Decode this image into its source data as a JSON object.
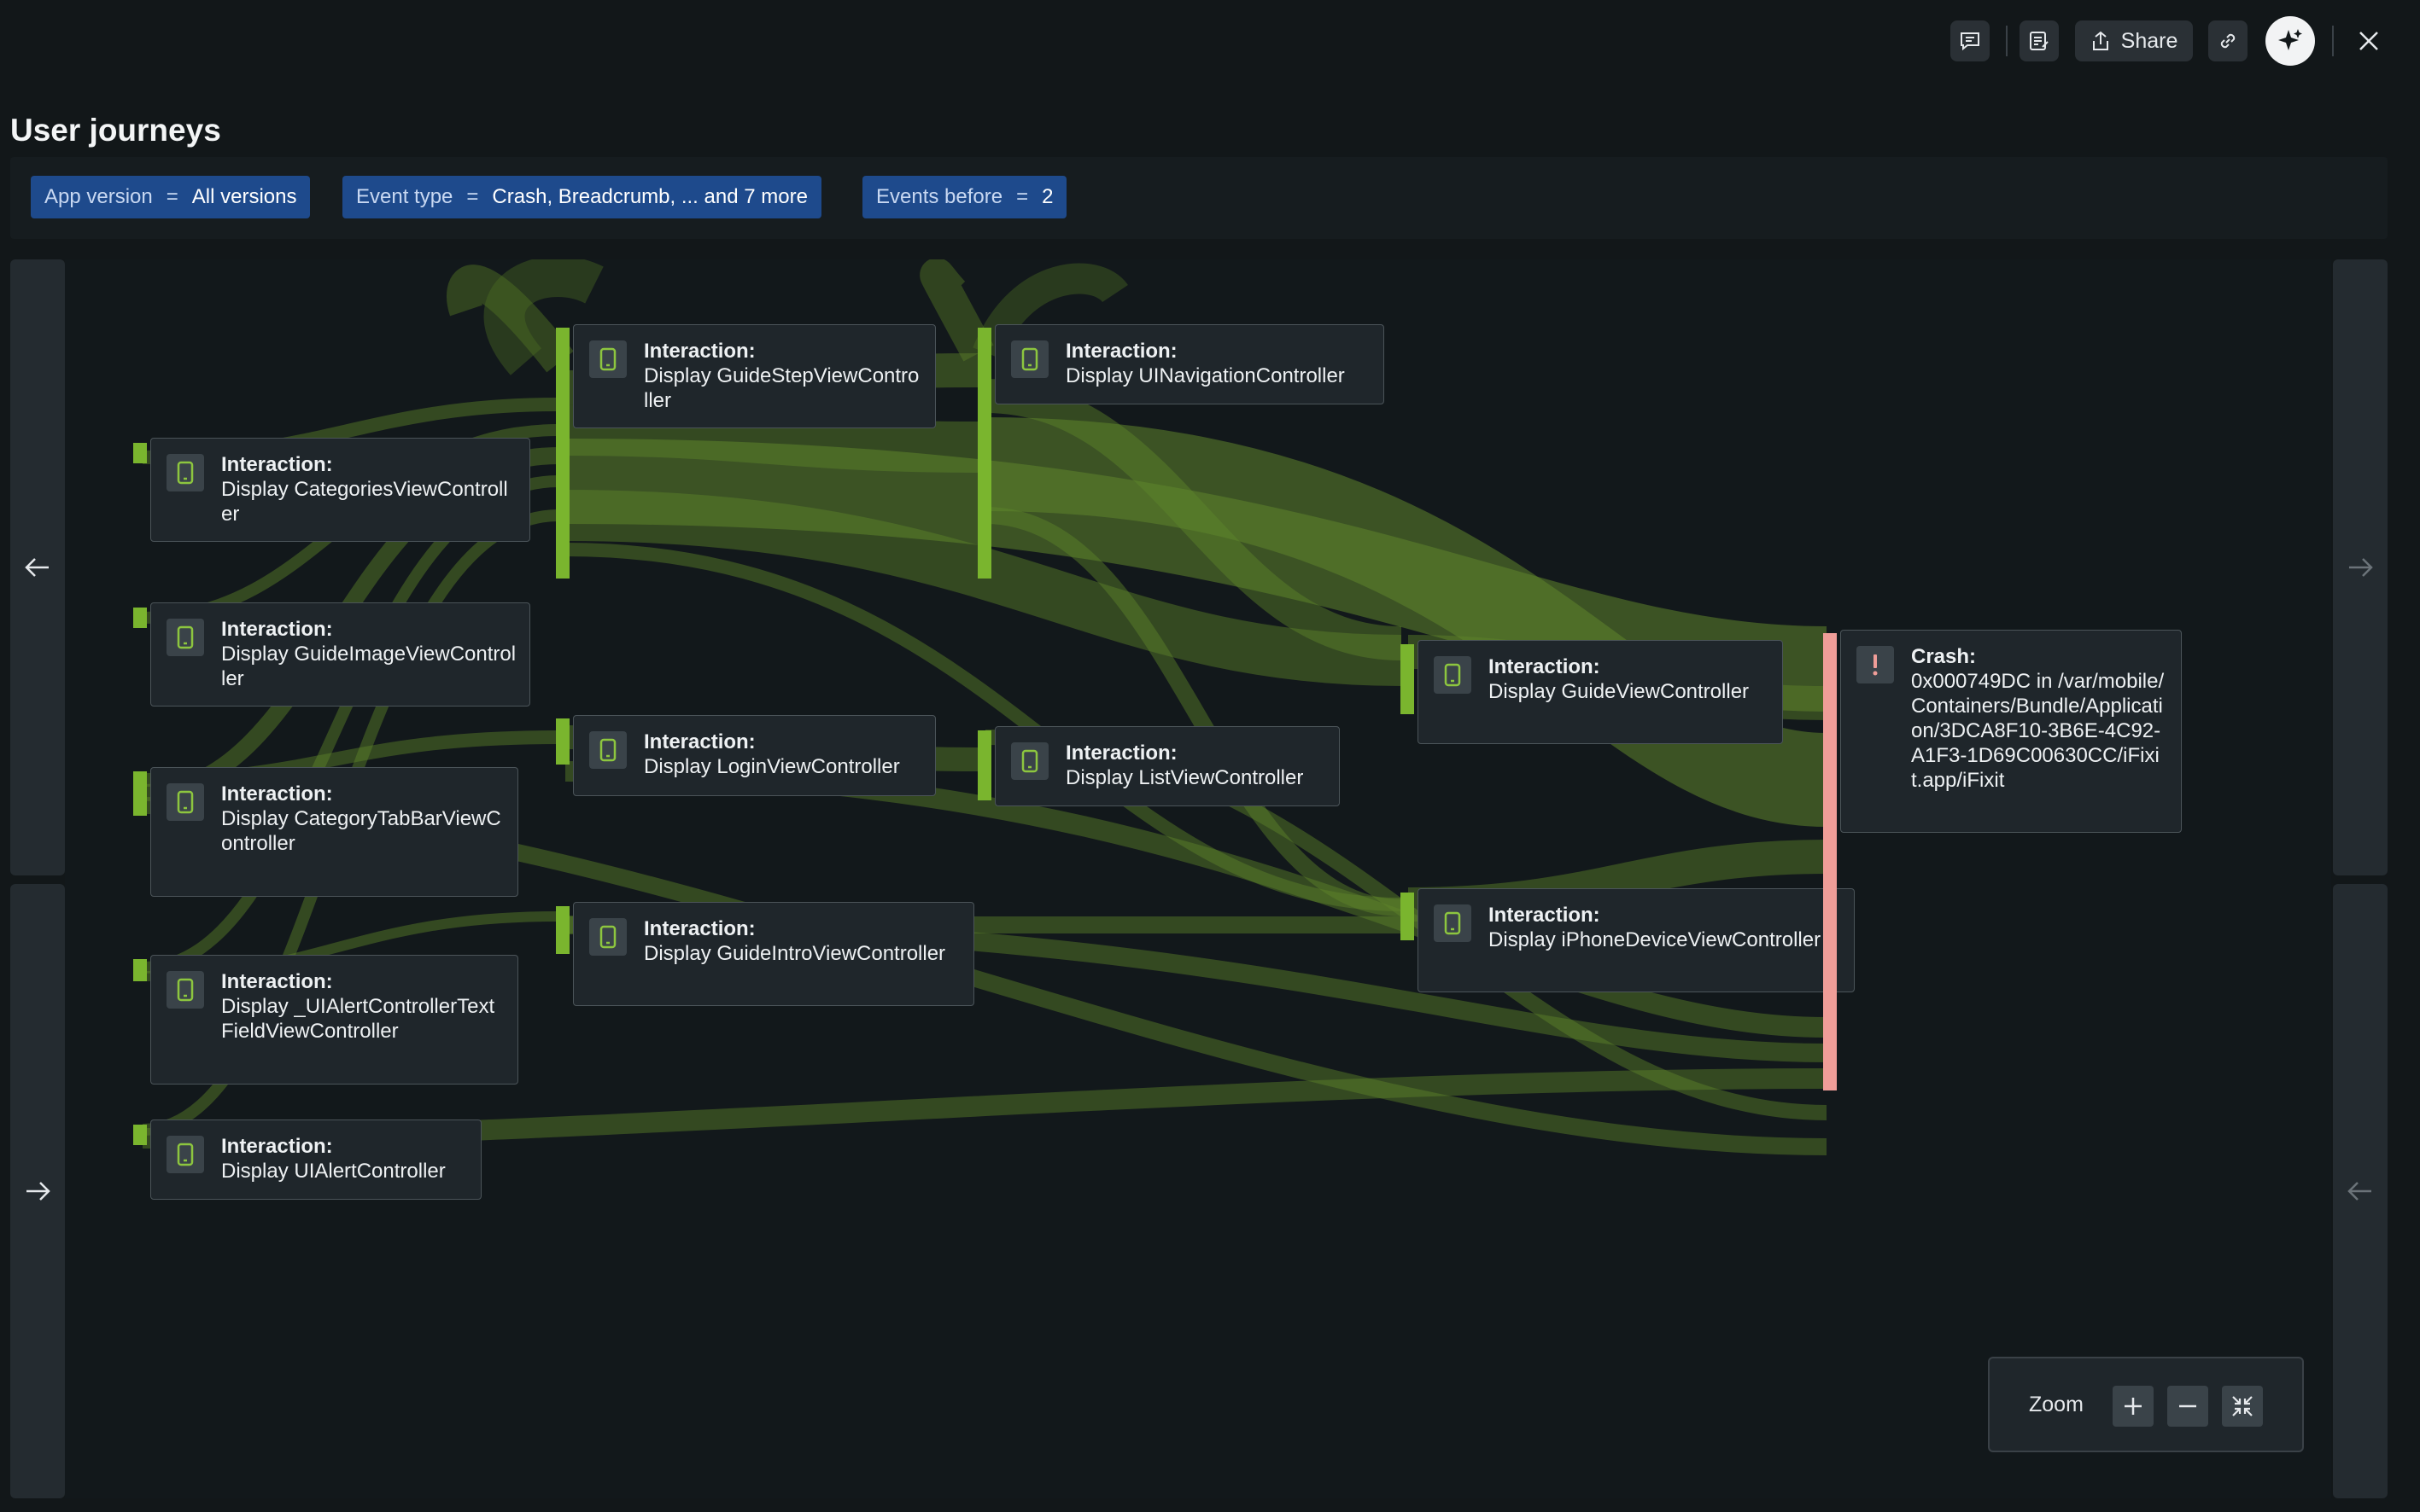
{
  "toolbar": {
    "share_label": "Share",
    "icons": [
      "comment-icon",
      "notes-icon",
      "share-icon",
      "link-icon",
      "sparkle-icon",
      "close-icon"
    ]
  },
  "page": {
    "title": "User journeys"
  },
  "filters": [
    {
      "key": "App version",
      "op": "=",
      "value": "All versions"
    },
    {
      "key": "Event type",
      "op": "=",
      "value": "Crash, Breadcrumb, ... and 7 more"
    },
    {
      "key": "Events before",
      "op": "=",
      "value": "2"
    }
  ],
  "nodes": {
    "categories": {
      "kind": "Interaction:",
      "label": "Display CategoriesViewController"
    },
    "guide_image": {
      "kind": "Interaction:",
      "label": "Display GuideImageViewController"
    },
    "category_tabbar": {
      "kind": "Interaction:",
      "label": "Display CategoryTabBarViewController"
    },
    "alert_textfield": {
      "kind": "Interaction:",
      "label": "Display _UIAlertControllerTextFieldViewController"
    },
    "alert": {
      "kind": "Interaction:",
      "label": "Display UIAlertController"
    },
    "guide_step": {
      "kind": "Interaction:",
      "label": "Display GuideStepViewController"
    },
    "login": {
      "kind": "Interaction:",
      "label": "Display LoginViewController"
    },
    "guide_intro": {
      "kind": "Interaction:",
      "label": "Display GuideIntroViewController"
    },
    "navigation": {
      "kind": "Interaction:",
      "label": "Display UINavigationController"
    },
    "list": {
      "kind": "Interaction:",
      "label": "Display ListViewController"
    },
    "guide": {
      "kind": "Interaction:",
      "label": "Display GuideViewController"
    },
    "iphone_device": {
      "kind": "Interaction:",
      "label": "Display iPhoneDeviceViewController"
    },
    "crash": {
      "kind": "Crash:",
      "label": "0x000749DC in /var/mobile/Containers/Bundle/Application/3DCA8F10-3B6E-4C92-A1F3-1D69C00630CC/iFixit.app/iFixit"
    }
  },
  "zoom": {
    "label": "Zoom"
  },
  "colors": {
    "accent_green": "#7ab52e",
    "flow_green": "#5a7f2a",
    "crash_pink": "#ef9d98",
    "chip_blue": "#1e4a8c",
    "background": "#121719"
  }
}
